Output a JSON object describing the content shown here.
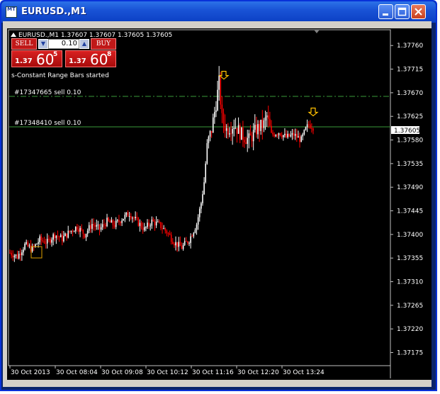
{
  "window": {
    "title": "EURUSD.,M1",
    "icon_label": "MT",
    "controls": [
      "minimize",
      "maximize",
      "close"
    ]
  },
  "chart_header": {
    "text": "EURUSD.,M1  1.37607 1.37607 1.37605 1.37605"
  },
  "trade_panel": {
    "sell_label": "SELL",
    "buy_label": "BUY",
    "lot_value": "0.10",
    "sell_price": {
      "prefix": "1.37",
      "main": "60",
      "sup": "5"
    },
    "buy_price": {
      "prefix": "1.37",
      "main": "60",
      "sup": "8"
    }
  },
  "messages": {
    "status": "s-Constant Range Bars started"
  },
  "order_lines": [
    {
      "label": "#17347665 sell 0.10",
      "price": 1.37663
    },
    {
      "label": "#17348410 sell 0.10",
      "price": 1.37605
    }
  ],
  "price_axis": {
    "ticks": [
      "1.37760",
      "1.37715",
      "1.37670",
      "1.37625",
      "1.37580",
      "1.37535",
      "1.37490",
      "1.37445",
      "1.37400",
      "1.37355",
      "1.37310",
      "1.37265",
      "1.37220",
      "1.37175"
    ],
    "current_price": "1.37605"
  },
  "time_axis": {
    "ticks": [
      "30 Oct 2013",
      "30 Oct 08:04",
      "30 Oct 09:08",
      "30 Oct 10:12",
      "30 Oct 11:16",
      "30 Oct 12:20",
      "30 Oct 13:24"
    ]
  },
  "chart_data": {
    "type": "candlestick",
    "symbol": "EURUSD.",
    "timeframe": "M1",
    "ylim": [
      1.3715,
      1.3779
    ],
    "x_labels": [
      "30 Oct 2013",
      "30 Oct 08:04",
      "30 Oct 09:08",
      "30 Oct 10:12",
      "30 Oct 11:16",
      "30 Oct 12:20",
      "30 Oct 13:24"
    ],
    "close_path_keypoints": [
      [
        0,
        1.37365
      ],
      [
        5,
        1.37358
      ],
      [
        10,
        1.3738
      ],
      [
        15,
        1.37372
      ],
      [
        20,
        1.3739
      ],
      [
        25,
        1.37385
      ],
      [
        30,
        1.374
      ],
      [
        35,
        1.37392
      ],
      [
        40,
        1.37405
      ],
      [
        45,
        1.37415
      ],
      [
        50,
        1.374
      ],
      [
        55,
        1.3742
      ],
      [
        60,
        1.3741
      ],
      [
        65,
        1.37425
      ],
      [
        70,
        1.37418
      ],
      [
        75,
        1.3743
      ],
      [
        80,
        1.3744
      ],
      [
        85,
        1.37425
      ],
      [
        90,
        1.3741
      ],
      [
        95,
        1.37425
      ],
      [
        100,
        1.37418
      ],
      [
        105,
        1.37405
      ],
      [
        110,
        1.37385
      ],
      [
        115,
        1.37375
      ],
      [
        120,
        1.3739
      ],
      [
        125,
        1.3742
      ],
      [
        128,
        1.3746
      ],
      [
        130,
        1.375
      ],
      [
        132,
        1.3757
      ],
      [
        135,
        1.376
      ],
      [
        138,
        1.3765
      ],
      [
        140,
        1.3769
      ],
      [
        142,
        1.3762
      ],
      [
        145,
        1.376
      ],
      [
        150,
        1.3761
      ],
      [
        155,
        1.3759
      ],
      [
        160,
        1.3758
      ],
      [
        165,
        1.376
      ],
      [
        170,
        1.3761
      ],
      [
        172,
        1.37625
      ],
      [
        175,
        1.3759
      ],
      [
        180,
        1.37595
      ],
      [
        185,
        1.37585
      ],
      [
        190,
        1.3759
      ],
      [
        195,
        1.3758
      ],
      [
        198,
        1.376
      ],
      [
        200,
        1.3761
      ],
      [
        203,
        1.37605
      ]
    ],
    "current_price": 1.37605,
    "arrows": [
      {
        "type": "sell-arrow",
        "price": 1.377
      },
      {
        "type": "sell-arrow",
        "price": 1.3763
      }
    ],
    "order_levels": [
      1.37663,
      1.37605
    ],
    "colors": {
      "up": "#FFFFFF",
      "down": "#FF0000",
      "order_line": "#2E8B2E",
      "arrow": "#FFC000",
      "grid": "none"
    }
  },
  "colors": {
    "chart_bg": "#000000",
    "axis_text": "#FFFFFF",
    "price_label_bg": "#FFFFFF",
    "order_line": "#3A9A3A",
    "title_bar": "#1953D6"
  }
}
